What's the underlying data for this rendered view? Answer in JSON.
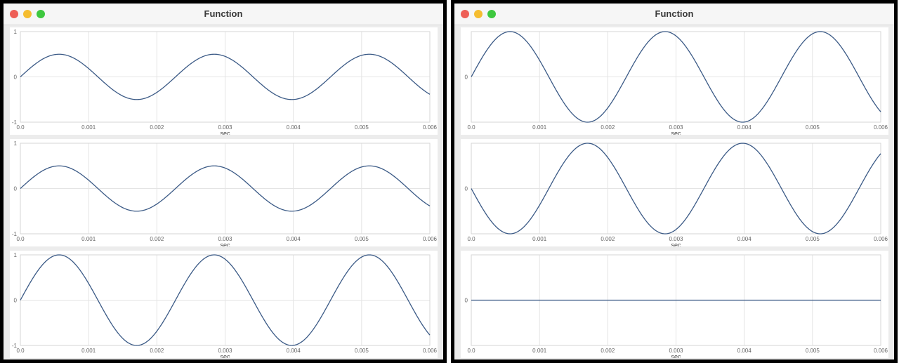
{
  "windows": [
    {
      "title": "Function"
    },
    {
      "title": "Function"
    }
  ],
  "chart_data": [
    {
      "type": "line",
      "xlabel": "sec",
      "xlim": [
        0,
        0.006
      ],
      "ylim": [
        -1,
        1
      ],
      "xticks": [
        "0.0",
        "0.001",
        "0.002",
        "0.003",
        "0.004",
        "0.005",
        "0.006"
      ],
      "yticks": [
        "1",
        "0",
        "-1"
      ],
      "series": [
        {
          "function": "0.5*sin(2*pi*440*t)",
          "amplitude": 0.5,
          "frequency_hz": 440,
          "phase": 0
        }
      ]
    },
    {
      "type": "line",
      "xlabel": "sec",
      "xlim": [
        0,
        0.006
      ],
      "ylim": [
        -1,
        1
      ],
      "xticks": [
        "0.0",
        "0.001",
        "0.002",
        "0.003",
        "0.004",
        "0.005",
        "0.006"
      ],
      "yticks": [
        "1",
        "0",
        "-1"
      ],
      "series": [
        {
          "function": "0.5*sin(2*pi*440*t)",
          "amplitude": 0.5,
          "frequency_hz": 440,
          "phase": 0
        }
      ]
    },
    {
      "type": "line",
      "xlabel": "sec",
      "xlim": [
        0,
        0.006
      ],
      "ylim": [
        -1,
        1
      ],
      "xticks": [
        "0.0",
        "0.001",
        "0.002",
        "0.003",
        "0.004",
        "0.005",
        "0.006"
      ],
      "yticks": [
        "1",
        "0",
        "-1"
      ],
      "series": [
        {
          "function": "sin(2*pi*440*t)",
          "amplitude": 1,
          "frequency_hz": 440,
          "phase": 0
        }
      ]
    },
    {
      "type": "line",
      "xlabel": "sec",
      "xlim": [
        0,
        0.006
      ],
      "ylim": [
        -1,
        1
      ],
      "xticks": [
        "0.0",
        "0.001",
        "0.002",
        "0.003",
        "0.004",
        "0.005",
        "0.006"
      ],
      "yticks": [
        "0"
      ],
      "series": [
        {
          "function": "sin(2*pi*440*t)",
          "amplitude": 1,
          "frequency_hz": 440,
          "phase": 0
        }
      ]
    },
    {
      "type": "line",
      "xlabel": "sec",
      "xlim": [
        0,
        0.006
      ],
      "ylim": [
        -1,
        1
      ],
      "xticks": [
        "0.0",
        "0.001",
        "0.002",
        "0.003",
        "0.004",
        "0.005",
        "0.006"
      ],
      "yticks": [
        "0"
      ],
      "series": [
        {
          "function": "-sin(2*pi*440*t)",
          "amplitude": -1,
          "frequency_hz": 440,
          "phase": 0
        }
      ]
    },
    {
      "type": "line",
      "xlabel": "sec",
      "xlim": [
        0,
        0.006
      ],
      "ylim": [
        -1,
        1
      ],
      "xticks": [
        "0.0",
        "0.001",
        "0.002",
        "0.003",
        "0.004",
        "0.005",
        "0.006"
      ],
      "yticks": [
        "0"
      ],
      "series": [
        {
          "function": "0",
          "amplitude": 0,
          "frequency_hz": 440,
          "phase": 0
        }
      ]
    }
  ],
  "colors": {
    "line": "#3b5a86",
    "grid": "#e4e4e4",
    "frame": "#d6d6d6"
  }
}
